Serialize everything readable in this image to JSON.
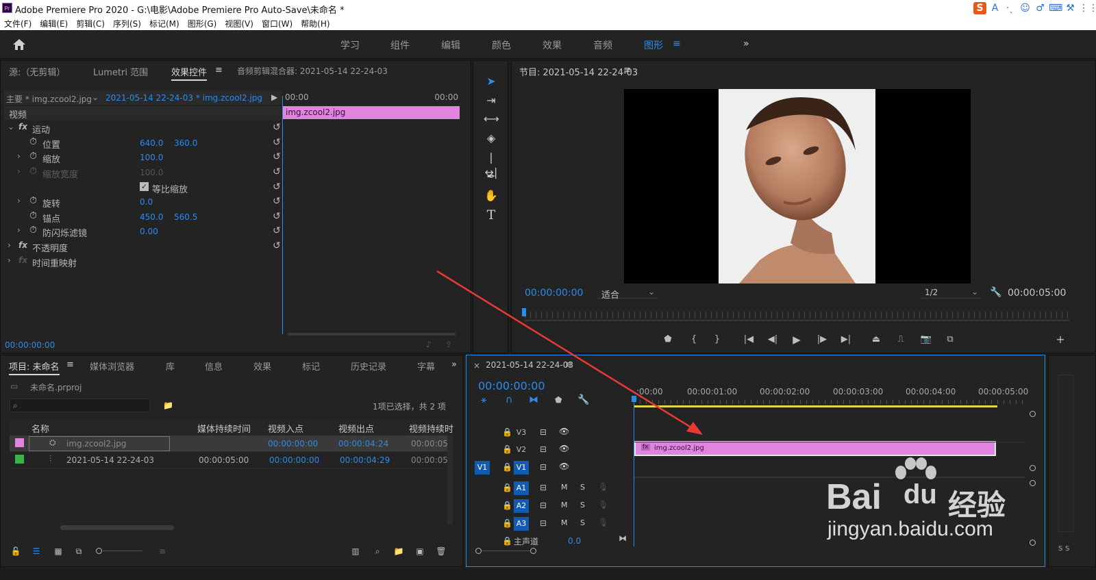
{
  "window": {
    "title": "Adobe Premiere Pro 2020 - G:\\电影\\Adobe Premiere Pro Auto-Save\\未命名 *",
    "logo": "Pr"
  },
  "ime": {
    "icons": [
      "S",
      "A",
      "·ˎ",
      "☺",
      "♂",
      "⌨",
      "⚒",
      "⋮⋮"
    ]
  },
  "menu": [
    "文件(F)",
    "编辑(E)",
    "剪辑(C)",
    "序列(S)",
    "标记(M)",
    "图形(G)",
    "视图(V)",
    "窗口(W)",
    "帮助(H)"
  ],
  "workspaces": [
    "学习",
    "组件",
    "编辑",
    "颜色",
    "效果",
    "音频",
    "图形"
  ],
  "workspace_more": "»",
  "effects": {
    "tabs": [
      "源:（无剪辑）",
      "Lumetri 范围",
      "效果控件",
      "音频剪辑混合器: 2021-05-14 22-24-03"
    ],
    "master": "主要 * img.zcool2.jpg",
    "sequence": "2021-05-14 22-24-03 * img.zcool2.jpg",
    "ruler_start": "00:00",
    "ruler_end": "00:00",
    "clip_name": "img.zcool2.jpg",
    "section": "视频",
    "motion": "运动",
    "position_label": "位置",
    "position_x": "640.0",
    "position_y": "360.0",
    "scale_label": "缩放",
    "scale_val": "100.0",
    "scale_width_label": "缩放宽度",
    "scale_width_val": "100.0",
    "uniform_label": "等比缩放",
    "rotation_label": "旋转",
    "rotation_val": "0.0",
    "anchor_label": "锚点",
    "anchor_x": "450.0",
    "anchor_y": "560.5",
    "flicker_label": "防闪烁滤镜",
    "flicker_val": "0.00",
    "opacity_label": "不透明度",
    "time_remap_label": "时间重映射",
    "timecode": "00:00:00:00"
  },
  "program": {
    "title": "节目: 2021-05-14 22-24-03",
    "timecode": "00:00:00:00",
    "fit": "适合",
    "resolution": "1/2",
    "duration": "00:00:05:00"
  },
  "project": {
    "tabs": [
      "项目: 未命名",
      "媒体浏览器",
      "库",
      "信息",
      "效果",
      "标记",
      "历史记录",
      "字幕"
    ],
    "file": "未命名.prproj",
    "selection": "1项已选择，共 2 项",
    "columns": [
      "名称",
      "媒体持续时间",
      "视频入点",
      "视频出点",
      "视频持续时"
    ],
    "items": [
      {
        "name": "img.zcool2.jpg",
        "duration": "",
        "in": "00:00:00:00",
        "out": "00:00:04:24",
        "vdur": "00:00:05:0"
      },
      {
        "name": "2021-05-14 22-24-03",
        "duration": "00:00:05:00",
        "in": "00:00:00:00",
        "out": "00:00:04:29",
        "vdur": "00:00:05:0"
      }
    ]
  },
  "timeline": {
    "title": "2021-05-14 22-24-03",
    "timecode": "00:00:00:00",
    "ruler": [
      ":00:00",
      "00:00:01:00",
      "00:00:02:00",
      "00:00:03:00",
      "00:00:04:00",
      "00:00:05:00"
    ],
    "tracks": [
      "V3",
      "V2",
      "V1",
      "A1",
      "A2",
      "A3"
    ],
    "source_patch": "V1",
    "master_label": "主声道",
    "master_val": "0.0",
    "clip": "img.zcool2.jpg",
    "m": "M",
    "s": "S"
  },
  "watermark": {
    "brand": "Bai",
    "brand2": "du",
    "cn": "经验",
    "url": "jingyan.baidu.com"
  },
  "colors": {
    "accent": "#2d8ceb",
    "clip": "#e084e0",
    "arrow": "#e63a32"
  }
}
